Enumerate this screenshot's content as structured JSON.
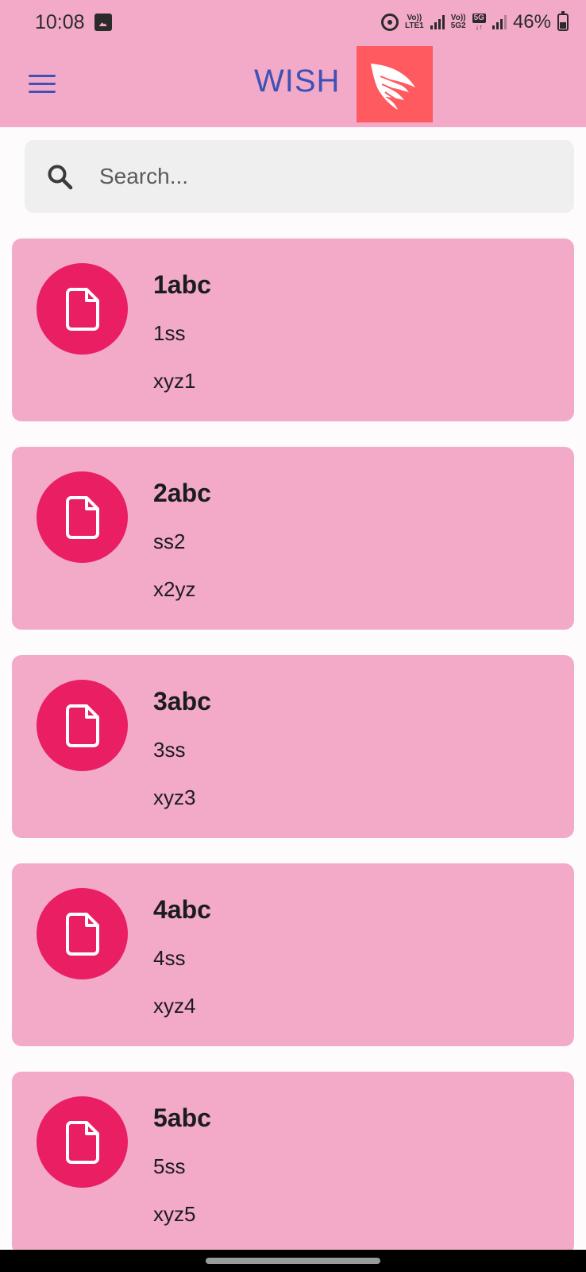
{
  "status_bar": {
    "time": "10:08",
    "sim1_label_top": "Vo))",
    "sim1_label_bottom": "LTE1",
    "sim2_label_top": "Vo))",
    "sim2_label_bottom": "5G2",
    "network_badge": "5G",
    "battery": "46%",
    "icons": [
      "gallery-icon",
      "hotspot-icon",
      "signal-icon",
      "battery-icon"
    ]
  },
  "app_bar": {
    "title": "WISH",
    "menu_icon": "hamburger-menu-icon",
    "logo": "wing-logo",
    "colors": {
      "bar": "#f3aac9",
      "title": "#3f51b5",
      "logo_bg": "#ff5a5f"
    }
  },
  "search": {
    "placeholder": "Search...",
    "value": "",
    "icon": "search-icon"
  },
  "items": [
    {
      "title": "1abc",
      "line1": "1ss",
      "line2": "xyz1"
    },
    {
      "title": "2abc",
      "line1": "ss2",
      "line2": "x2yz"
    },
    {
      "title": "3abc",
      "line1": "3ss",
      "line2": "xyz3"
    },
    {
      "title": "4abc",
      "line1": "4ss",
      "line2": "xyz4"
    },
    {
      "title": "5abc",
      "line1": "5ss",
      "line2": "xyz5"
    }
  ],
  "item_icon": "file-icon",
  "colors": {
    "card": "#f3aac9",
    "avatar": "#e91e63"
  }
}
